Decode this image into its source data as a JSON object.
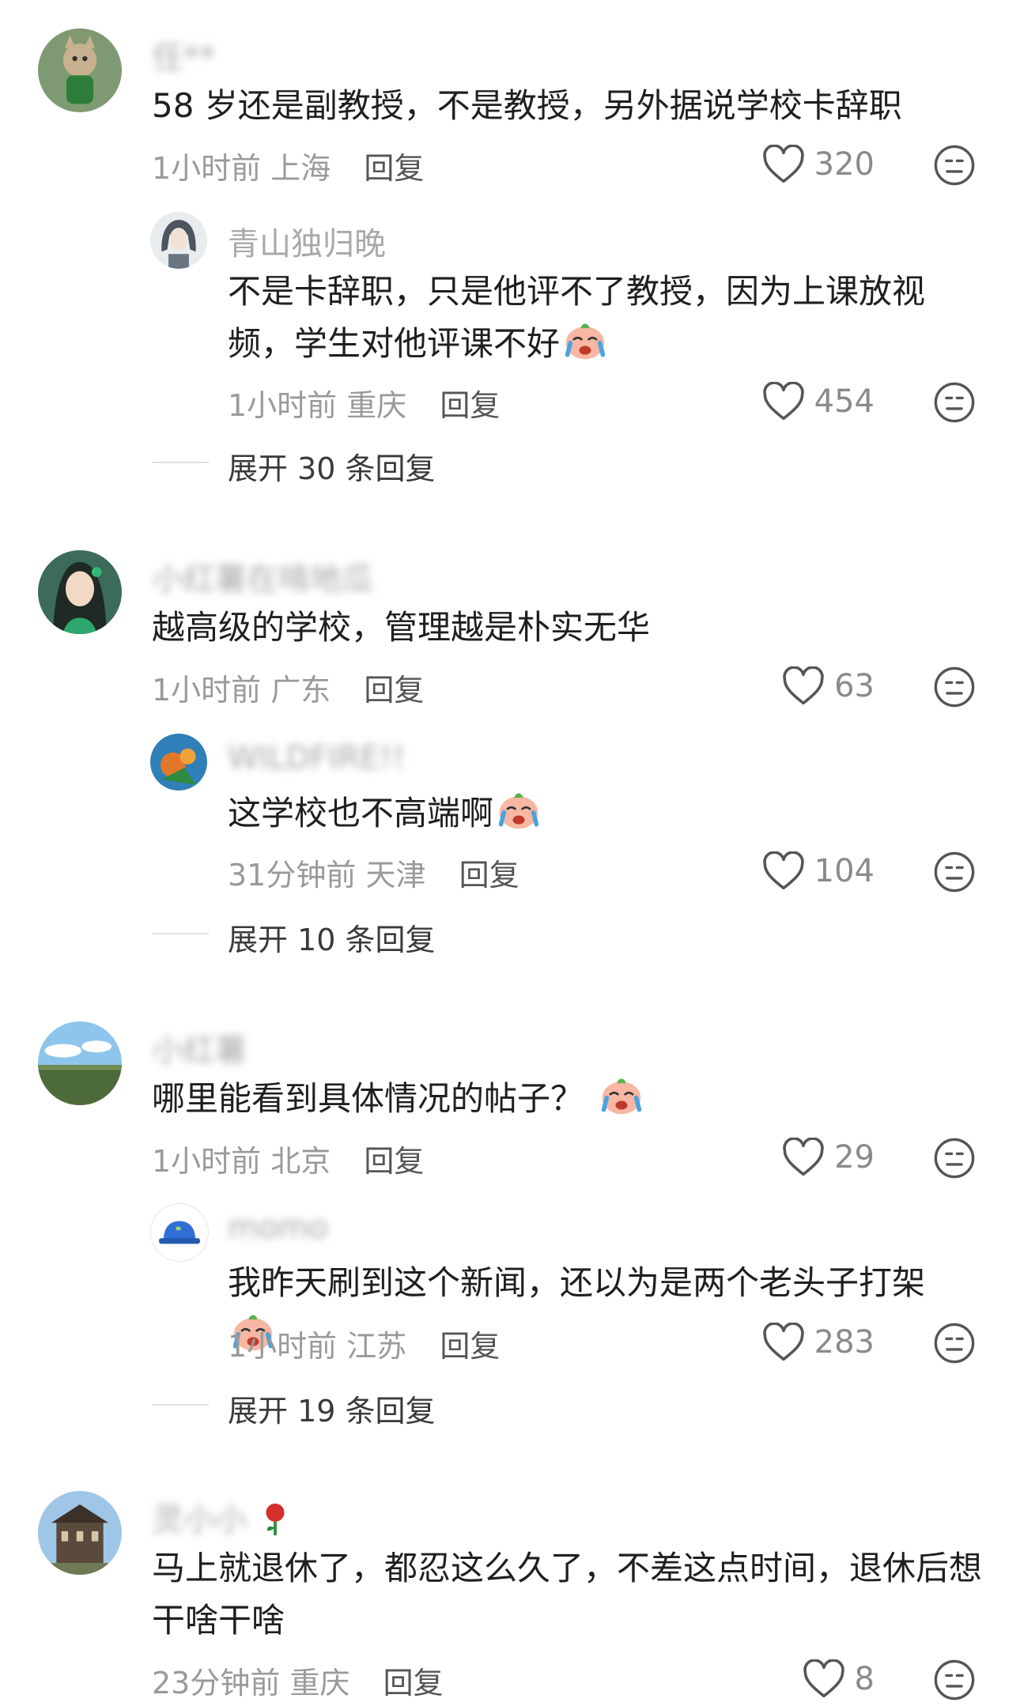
{
  "comments": [
    {
      "username": "任**",
      "text": "58 岁还是副教授，不是教授，另外据说学校卡辞职",
      "time": "1小时前",
      "location": "上海",
      "reply_label": "回复",
      "likes": "320",
      "replies": [
        {
          "username": "青山独归晚",
          "text": "不是卡辞职，只是他评不了教授，因为上课放视频，学生对他评课不好",
          "time": "1小时前",
          "location": "重庆",
          "reply_label": "回复",
          "likes": "454"
        }
      ],
      "expand_label": "展开 30 条回复"
    },
    {
      "username": "小红薯在啃地瓜",
      "text": "越高级的学校，管理越是朴实无华",
      "time": "1小时前",
      "location": "广东",
      "reply_label": "回复",
      "likes": "63",
      "replies": [
        {
          "username": "WILDFIRE!!",
          "text": "这学校也不高端啊",
          "time": "31分钟前",
          "location": "天津",
          "reply_label": "回复",
          "likes": "104"
        }
      ],
      "expand_label": "展开 10 条回复"
    },
    {
      "username": "小红薯",
      "text": "哪里能看到具体情况的帖子？",
      "time": "1小时前",
      "location": "北京",
      "reply_label": "回复",
      "likes": "29",
      "replies": [
        {
          "username": "momo",
          "text": "我昨天刷到这个新闻，还以为是两个老头子打架",
          "time": "1小时前",
          "location": "江苏",
          "reply_label": "回复",
          "likes": "283"
        }
      ],
      "expand_label": "展开 19 条回复"
    },
    {
      "username": "灵小小",
      "text": "马上就退休了，都忍这么久了，不差这点时间，退休后想干啥干啥",
      "time": "23分钟前",
      "location": "重庆",
      "reply_label": "回复",
      "likes": "8"
    }
  ],
  "icons": {
    "like": "heart-outline-icon",
    "react": "neutral-face-icon",
    "emoji": "crying-face-emoji"
  },
  "colors": {
    "text": "#1f1f1f",
    "meta": "#9a9a9a",
    "username": "#a9a9a9",
    "icon": "#555555"
  }
}
